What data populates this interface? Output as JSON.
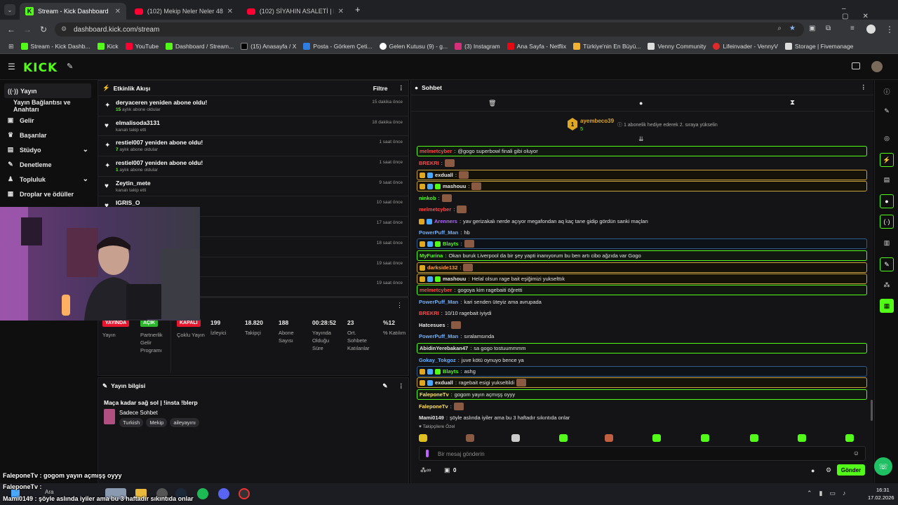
{
  "browser": {
    "tabs": [
      {
        "label": "Stream - Kick Dashboard",
        "active": true
      },
      {
        "label": "(102) Mekip Neler Neler 48.Böl...",
        "active": false
      },
      {
        "label": "(102) SİYAHIN ASALETİ | Madar...",
        "active": false
      }
    ],
    "url": "dashboard.kick.com/stream",
    "bookmarks": [
      "Stream - Kick Dashb...",
      "Kick",
      "YouTube",
      "Dashboard / Stream...",
      "(15) Anasayfa / X",
      "Posta - Görkem Çeti...",
      "Gelen Kutusu (9) - g...",
      "(3) Instagram",
      "Ana Sayfa - Netflix",
      "Türkiye'nin En Büyü...",
      "Venny Community",
      "Lifeinvader - VennyV",
      "Storage | Fivemanage"
    ]
  },
  "kick": {
    "logo": "KICK"
  },
  "sidebar": {
    "items": [
      {
        "label": "Yayın",
        "icon": "broadcast-icon"
      },
      {
        "label": "Yayın Bağlantısı ve Anahtarı",
        "icon": ""
      },
      {
        "label": "Gelir",
        "icon": "wallet-icon"
      },
      {
        "label": "Başarılar",
        "icon": "trophy-icon"
      },
      {
        "label": "Stüdyo",
        "icon": "studio-icon"
      },
      {
        "label": "Denetleme",
        "icon": "wrench-icon"
      },
      {
        "label": "Topluluk",
        "icon": "community-icon"
      },
      {
        "label": "Droplar ve ödüller",
        "icon": "gift-icon"
      }
    ]
  },
  "activity": {
    "title": "Etkinlik Akışı",
    "filter": "Filtre",
    "events": [
      {
        "title": "deryaceren yeniden abone oldu!",
        "sub_num": "15",
        "sub": " aylık abone oldular",
        "time": "15 dakika önce",
        "icon": "sparkle"
      },
      {
        "title": "elmalisoda3131",
        "sub_num": "",
        "sub": "kanalı takip etti",
        "time": "18 dakika önce",
        "icon": "heart"
      },
      {
        "title": "restiel007 yeniden abone oldu!",
        "sub_num": "7",
        "sub": " aylık abone oldular",
        "time": "1 saat önce",
        "icon": "sparkle"
      },
      {
        "title": "restiel007 yeniden abone oldu!",
        "sub_num": "1",
        "sub": " aylık abone oldular",
        "time": "1 saat önce",
        "icon": "sparkle"
      },
      {
        "title": "Zeytin_mete",
        "sub_num": "",
        "sub": "kanalı takip etti",
        "time": "9 saat önce",
        "icon": "heart"
      },
      {
        "title": "IGRIS_O",
        "sub_num": "",
        "sub": "",
        "time": "10 saat önce",
        "icon": "heart"
      },
      {
        "title": "",
        "sub_num": "",
        "sub": "",
        "time": "17 saat önce",
        "icon": ""
      },
      {
        "title": "",
        "sub_num": "",
        "sub": "",
        "time": "18 saat önce",
        "icon": ""
      },
      {
        "title": "",
        "sub_num": "",
        "sub": "",
        "time": "19 saat önce",
        "icon": ""
      },
      {
        "title": "",
        "sub_num": "",
        "sub": "",
        "time": "19 saat önce",
        "icon": ""
      }
    ]
  },
  "stats": {
    "status": [
      {
        "badge": "YAYINDA",
        "label": "Yayın",
        "color": "#e5162d"
      },
      {
        "badge": "AÇIK",
        "label": "Partnerlik Gelir Programı",
        "color": "#2bb52b"
      },
      {
        "badge": "KAPALI",
        "label": "Çoklu Yayın",
        "color": "#e5162d"
      }
    ],
    "numbers": [
      {
        "value": "199",
        "label": "İzleyici"
      },
      {
        "value": "18.820",
        "label": "Takipçi"
      },
      {
        "value": "188",
        "label": "Abone Sayısı"
      },
      {
        "value": "00:28:52",
        "label": "Yayında Olduğu Süre"
      },
      {
        "value": "23",
        "label": "Ort. Sohbete Katılanlar"
      },
      {
        "value": "%12",
        "label": "% Katılım"
      }
    ]
  },
  "stream_info": {
    "title": "Yayın bilgisi",
    "stream_title": "Maça kadar sağ sol | !insta !blerp",
    "category": "Sadece Sohbet",
    "tags": [
      "Turkish",
      "Mekip",
      "aileyayını"
    ]
  },
  "chat": {
    "title": "Sohbet",
    "top_gifter": {
      "rank": "1",
      "name": "ayembeco39",
      "count": "5",
      "hint": "1 abonelik hediye ederek 2. sıraya yükselin"
    },
    "messages": [
      {
        "user": "melmetcyber",
        "color": "#ff4a4a",
        "text": "@gogo superbowl finali gibi oluyor",
        "style": "hl",
        "emote": false,
        "badges": 0
      },
      {
        "user": "BREKRI",
        "color": "#ff4a4a",
        "text": "",
        "style": "",
        "emote": true,
        "badges": 0
      },
      {
        "user": "exduall",
        "color": "#e8e8e8",
        "text": "",
        "style": "gold",
        "emote": true,
        "badges": 2
      },
      {
        "user": "mashouu",
        "color": "#e8e8e8",
        "text": "",
        "style": "gold",
        "emote": true,
        "badges": 3
      },
      {
        "user": "ninkob",
        "color": "#53fc18",
        "text": "",
        "style": "",
        "emote": true,
        "badges": 0
      },
      {
        "user": "melmetcyber",
        "color": "#ff4a4a",
        "text": "",
        "style": "",
        "emote": true,
        "badges": 0
      },
      {
        "user": "Arenners",
        "color": "#b06cff",
        "text": "yav gerizakalı nerde açıyor megafondan aq kaç tane gidip gördün sanki maçları",
        "style": "",
        "emote": false,
        "badges": 2
      },
      {
        "user": "PowerPuff_Man",
        "color": "#6ab0ff",
        "text": "hb",
        "style": "",
        "emote": false,
        "badges": 0
      },
      {
        "user": "Blayts",
        "color": "#53fc18",
        "text": "",
        "style": "blue",
        "emote": true,
        "badges": 3
      },
      {
        "user": "MyFurina",
        "color": "#53fc18",
        "text": "Okan buruk Liverpool da bir şey yapti inanıyorum bu ben artı cibo ağzıda var Gogo",
        "style": "hl",
        "emote": false,
        "badges": 0
      },
      {
        "user": "darkside132",
        "color": "#ff9f40",
        "text": "",
        "style": "gold",
        "emote": true,
        "badges": 1
      },
      {
        "user": "mashouu",
        "color": "#e8e8e8",
        "text": "Helal olsun rage bait eşiğimizi yukselttık",
        "style": "gold",
        "emote": false,
        "badges": 3
      },
      {
        "user": "melmetcyber",
        "color": "#ff4a4a",
        "text": "gogoya kim ragebaiti öğretti",
        "style": "hl",
        "emote": false,
        "badges": 0
      },
      {
        "user": "PowerPuff_Man",
        "color": "#6ab0ff",
        "text": "kari senden üteyiz ama avrupada",
        "style": "",
        "emote": false,
        "badges": 0
      },
      {
        "user": "BREKRI",
        "color": "#ff4a4a",
        "text": "10/10 ragebait iyiydi",
        "style": "",
        "emote": false,
        "badges": 0
      },
      {
        "user": "Hatcesues",
        "color": "#e8e8e8",
        "text": "",
        "style": "",
        "emote": true,
        "badges": 0
      },
      {
        "user": "PowerPuff_Man",
        "color": "#6ab0ff",
        "text": "sıralamsında",
        "style": "",
        "emote": false,
        "badges": 0
      },
      {
        "user": "AbidinYerebakan47",
        "color": "#e8e8e8",
        "text": "sa gogo tostuummmm",
        "style": "hl",
        "emote": false,
        "badges": 0
      },
      {
        "user": "Gokay_Tokgoz",
        "color": "#6ab0ff",
        "text": "juve kötü oynuyo bence ya",
        "style": "",
        "emote": false,
        "badges": 0
      },
      {
        "user": "Blayts",
        "color": "#53fc18",
        "text": "ashg",
        "style": "blue",
        "emote": false,
        "badges": 3
      },
      {
        "user": "exduall",
        "color": "#e8e8e8",
        "text": "ragebait esigi yukseltildi",
        "style": "gold",
        "emote": true,
        "badges": 2
      },
      {
        "user": "FaleponeTv",
        "color": "#ffe066",
        "text": "gogom yayın açmışş oyyy",
        "style": "hl",
        "emote": false,
        "badges": 0
      },
      {
        "user": "FaleponeTv",
        "color": "#ffe066",
        "text": "",
        "style": "",
        "emote": true,
        "badges": 0
      },
      {
        "user": "Mami0149",
        "color": "#e8e8e8",
        "text": "şöyle aslında iyiler ama bu 3 haftadır sıkıntıda onlar",
        "style": "",
        "emote": false,
        "badges": 0
      }
    ],
    "followers_only": "Takipçilere Özel",
    "input_placeholder": "Bir mesaj gönderin",
    "points": "0",
    "send": "Gönder"
  },
  "overlay": {
    "lines": [
      "FaleponeTv : gogom yayın açmışş oyyy",
      "FaleponeTv :",
      "Mami0149 : şöyle aslında iyiler ama bu 3 haftadır sıkıntıda onlar"
    ]
  },
  "taskbar": {
    "search": "Ara",
    "time": "16:31",
    "date": "17.02.2026"
  }
}
